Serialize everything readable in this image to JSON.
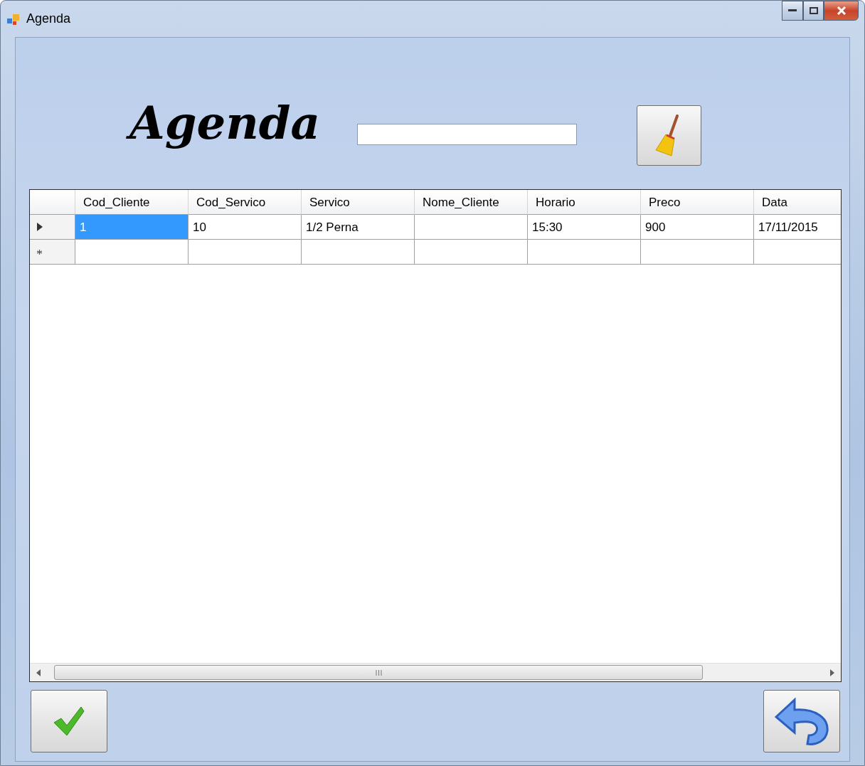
{
  "window": {
    "title": "Agenda"
  },
  "heading": "Agenda",
  "grid": {
    "columns": [
      "Cod_Cliente",
      "Cod_Servico",
      "Servico",
      "Nome_Cliente",
      "Horario",
      "Preco",
      "Data"
    ],
    "rows": [
      {
        "kind": "current",
        "cells": [
          {
            "text": "1",
            "selected": true
          },
          {
            "text": "10",
            "selected": false
          },
          {
            "text": "1/2 Perna",
            "selected": false
          },
          {
            "selected": false
          },
          {
            "text": "15:30",
            "selected": false
          },
          {
            "text": "900",
            "selected": false
          },
          {
            "text": "17/11/2015",
            "selected": false
          }
        ]
      },
      {
        "kind": "new",
        "cells": [
          {
            "selected": false
          },
          {
            "selected": false
          },
          {
            "selected": false
          },
          {
            "selected": false
          },
          {
            "selected": false
          },
          {
            "selected": false
          },
          {
            "selected": false
          }
        ]
      }
    ]
  }
}
